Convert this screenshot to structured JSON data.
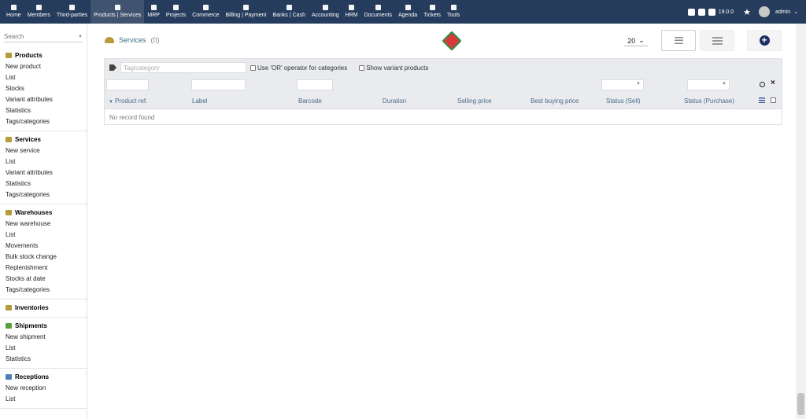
{
  "topmenu": [
    {
      "label": "Home",
      "icon": "home-icon"
    },
    {
      "label": "Members",
      "icon": "member-icon"
    },
    {
      "label": "Third-parties",
      "icon": "building-icon"
    },
    {
      "label": "Products | Services",
      "icon": "cube-icon",
      "active": true
    },
    {
      "label": "MRP",
      "icon": "cubes-icon"
    },
    {
      "label": "Projects",
      "icon": "project-icon"
    },
    {
      "label": "Commerce",
      "icon": "suitcase-icon"
    },
    {
      "label": "Billing | Payment",
      "icon": "invoice-icon"
    },
    {
      "label": "Banks | Cash",
      "icon": "bank-icon"
    },
    {
      "label": "Accounting",
      "icon": "search-dollar-icon"
    },
    {
      "label": "HRM",
      "icon": "user-tie-icon"
    },
    {
      "label": "Documents",
      "icon": "folder-icon"
    },
    {
      "label": "Agenda",
      "icon": "calendar-icon"
    },
    {
      "label": "Tickets",
      "icon": "ticket-icon"
    },
    {
      "label": "Tools",
      "icon": "tools-icon"
    }
  ],
  "topright": {
    "version": "19.0.0",
    "user": "admin"
  },
  "leftmenu": {
    "search_placeholder": "Search",
    "blocks": [
      {
        "title": "Products",
        "icon": "cube-icon",
        "color": "#b79a3b",
        "links": [
          "New product",
          "List",
          "Stocks",
          "Variant attributes",
          "Statistics",
          "Tags/categories"
        ]
      },
      {
        "title": "Services",
        "icon": "concierge-bell-icon",
        "color": "#b79a3b",
        "links": [
          "New service",
          "List",
          "Variant attributes",
          "Statistics",
          "Tags/categories"
        ]
      },
      {
        "title": "Warehouses",
        "icon": "box-open-icon",
        "color": "#b79a3b",
        "links": [
          "New warehouse",
          "List",
          "Movements",
          "Bulk stock change",
          "Replenishment",
          "Stocks at date",
          "Tags/categories"
        ]
      },
      {
        "title": "Inventories",
        "icon": "boxes-icon",
        "color": "#b79a3b",
        "links": []
      },
      {
        "title": "Shipments",
        "icon": "dolly-icon",
        "color": "#5aa13c",
        "links": [
          "New shipment",
          "List",
          "Statistics"
        ]
      },
      {
        "title": "Receptions",
        "icon": "truck-icon",
        "color": "#4a7fb8",
        "links": [
          "New reception",
          "List"
        ]
      }
    ]
  },
  "page": {
    "title": "Services",
    "count": "(0)",
    "per_page": "20"
  },
  "filters": {
    "tag_placeholder": "Tag/category",
    "or_operator_label": "Use 'OR' operator for categories",
    "variant_label": "Show variant products"
  },
  "columns": [
    "Product ref.",
    "Label",
    "Barcode",
    "Duration",
    "Selling price",
    "Best buying price",
    "Status (Sell)",
    "Status (Purchase)"
  ],
  "empty_message": "No record found"
}
